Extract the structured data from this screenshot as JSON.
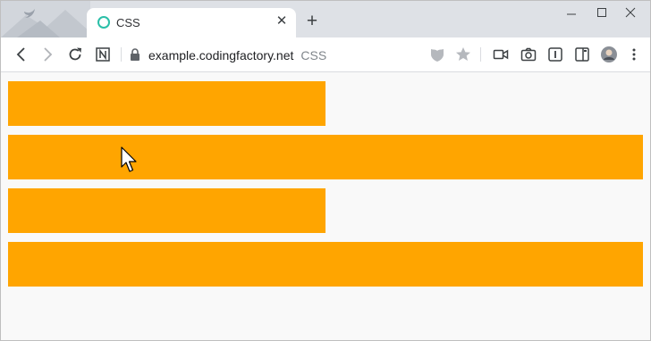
{
  "tab": {
    "title": "CSS"
  },
  "address_bar": {
    "domain": "example.codingfactory.net",
    "suffix": "CSS"
  },
  "colors": {
    "bar": "#ffa500",
    "page_background": "#f9f9f9",
    "favicon": "#2bbfa8"
  },
  "icons": {
    "favicon": "ring-icon",
    "tab_close": "close-icon",
    "new_tab": "plus-icon",
    "back": "back-arrow-icon",
    "forward": "forward-arrow-icon",
    "reload": "reload-icon",
    "extension": "notion-icon",
    "lock": "lock-icon",
    "shield": "shield-icon",
    "star": "star-icon",
    "video": "video-camera-icon",
    "camera": "camera-icon",
    "reader": "reader-mode-icon",
    "sidebar": "sidebar-icon",
    "avatar": "profile-avatar",
    "menu": "kebab-menu-icon"
  },
  "content": {
    "bars": [
      "half-width",
      "full-width",
      "half-width",
      "full-width"
    ]
  }
}
